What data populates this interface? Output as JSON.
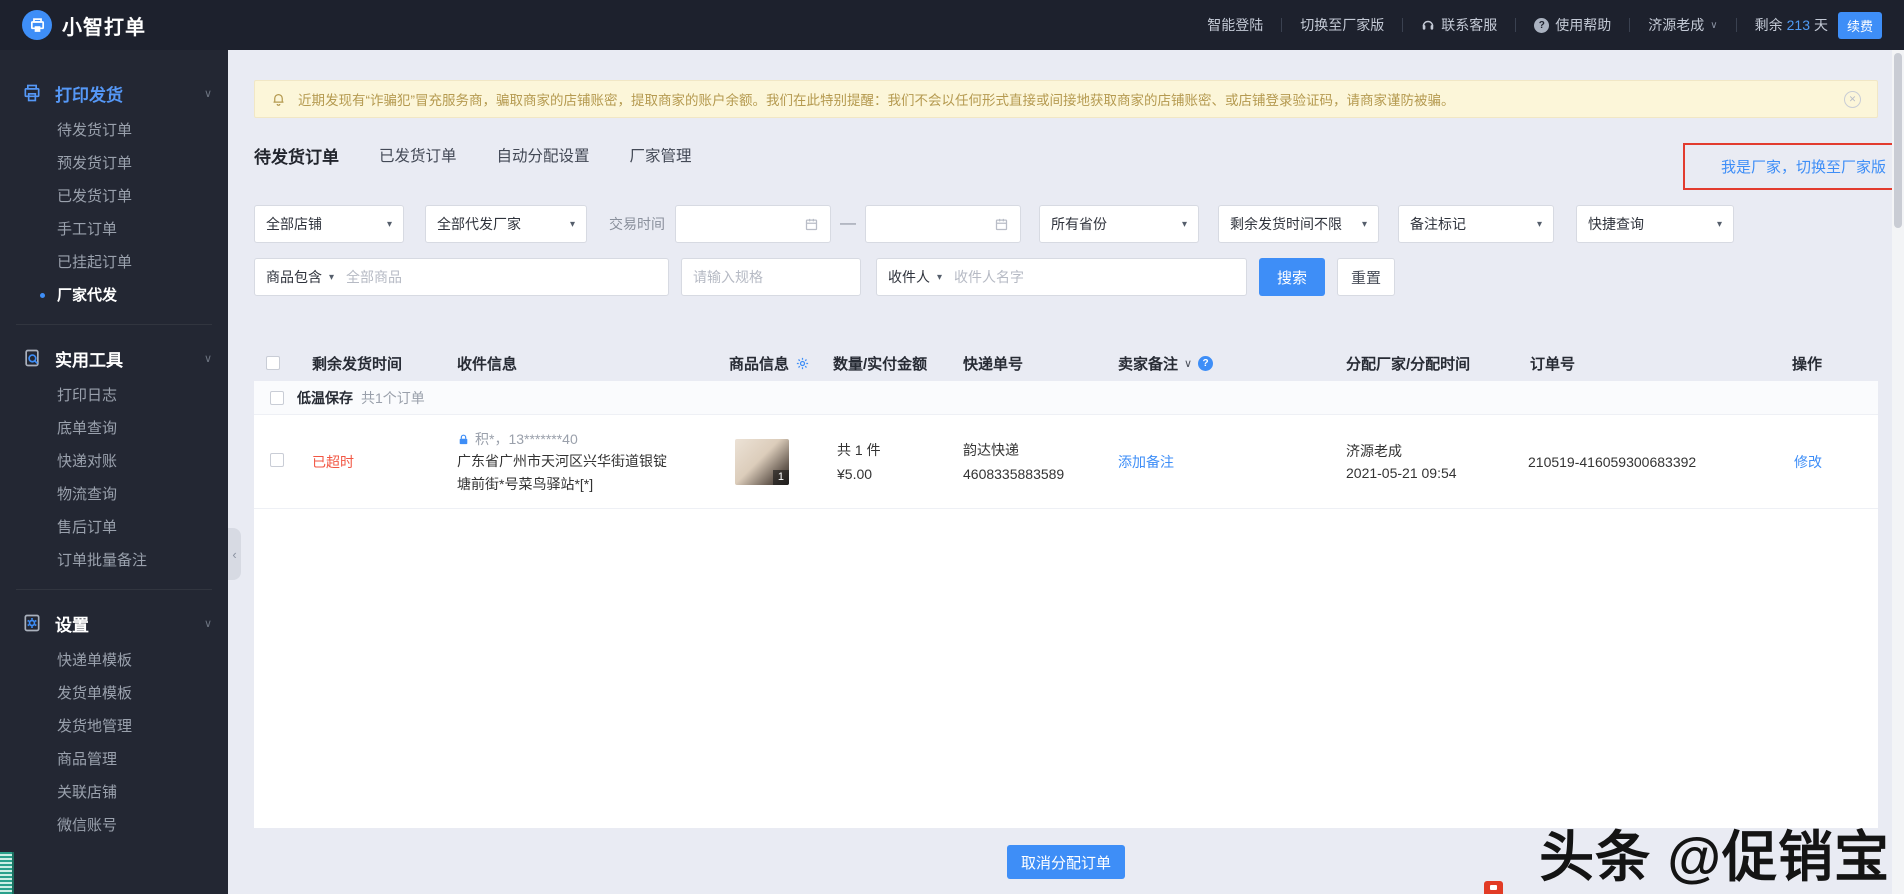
{
  "glyphs": {
    "caret": "▾",
    "chevron": "∨",
    "close": "✕",
    "question": "?",
    "collapse": "‹",
    "dash": "—"
  },
  "topbar": {
    "brand": "小智打单",
    "smart_login": "智能登陆",
    "switch_factory": "切换至厂家版",
    "contact_service": "联系客服",
    "help": "使用帮助",
    "username": "济源老成",
    "remaining_prefix": "剩余",
    "remaining_days": "213",
    "remaining_unit": "天",
    "renew": "续费"
  },
  "sidebar": {
    "sections": [
      {
        "title": "打印发货",
        "items": [
          "待发货订单",
          "预发货订单",
          "已发货订单",
          "手工订单",
          "已挂起订单",
          "厂家代发"
        ]
      },
      {
        "title": "实用工具",
        "items": [
          "打印日志",
          "底单查询",
          "快递对账",
          "物流查询",
          "售后订单",
          "订单批量备注"
        ]
      },
      {
        "title": "设置",
        "items": [
          "快递单模板",
          "发货单模板",
          "发货地管理",
          "商品管理",
          "关联店铺",
          "微信账号"
        ]
      }
    ],
    "active_item": "厂家代发"
  },
  "banner": {
    "text": "近期发现有“诈骗犯”冒充服务商，骗取商家的店铺账密，提取商家的账户余额。我们在此特别提醒：我们不会以任何形式直接或间接地获取商家的店铺账密、或店铺登录验证码，请商家谨防被骗。"
  },
  "tabs": [
    "待发货订单",
    "已发货订单",
    "自动分配设置",
    "厂家管理"
  ],
  "switch_link": "我是厂家，切换至厂家版",
  "filters": {
    "shop": "全部店铺",
    "factory": "全部代发厂家",
    "trade_time_label": "交易时间",
    "province": "所有省份",
    "remaining_time": "剩余发货时间不限",
    "remark_tag": "备注标记",
    "quick_query": "快捷查询",
    "product_contains": "商品包含",
    "product_placeholder": "全部商品",
    "spec_placeholder": "请输入规格",
    "receiver": "收件人",
    "receiver_placeholder": "收件人名字",
    "search": "搜索",
    "reset": "重置"
  },
  "table": {
    "headers": [
      "剩余发货时间",
      "收件信息",
      "商品信息",
      "数量/实付金额",
      "快递单号",
      "卖家备注",
      "分配厂家/分配时间",
      "订单号",
      "操作"
    ],
    "group": {
      "tag": "低温保存",
      "count": "共1个订单"
    },
    "row": {
      "status": "已超时",
      "recipient_masked": "积*，13*******40",
      "address_line1": "广东省广州市天河区兴华街道银锭",
      "address_line2": "塘前街*号菜鸟驿站*[*]",
      "img_badge": "1",
      "qty": "共 1 件",
      "amount": "¥5.00",
      "courier": "韵达快递",
      "tracking_no": "4608335883589",
      "remark_action": "添加备注",
      "factory": "济源老成",
      "assign_time": "2021-05-21 09:54",
      "order_no": "210519-416059300683392",
      "action": "修改"
    }
  },
  "footer": {
    "cancel_button": "取消分配订单"
  },
  "watermark": "头条 @促销宝",
  "colors": {
    "accent": "#3e8ef7",
    "topbar_bg": "#1d212d",
    "sidebar_bg": "#232733",
    "page_bg": "#e9ebf3",
    "warning_bg": "#fcf6d9",
    "warning_text": "#b59a50",
    "danger_text": "#f25643",
    "highlight_border": "#e23b2e"
  }
}
